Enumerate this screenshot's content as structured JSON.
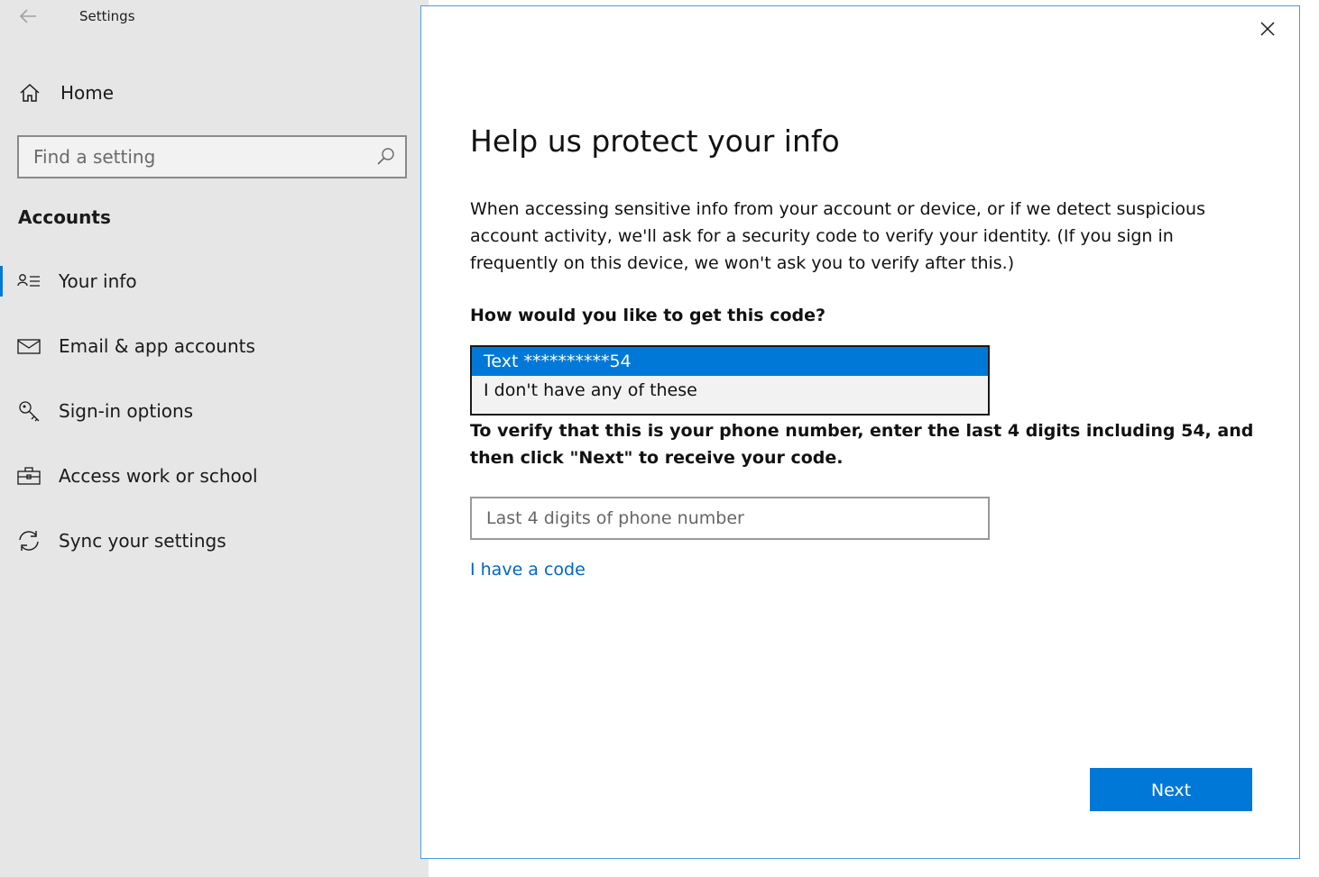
{
  "window": {
    "title": "Settings"
  },
  "sidebar": {
    "home_label": "Home",
    "search_placeholder": "Find a setting",
    "section_heading": "Accounts",
    "items": [
      {
        "label": "Your info",
        "icon": "person-list-icon",
        "active": true
      },
      {
        "label": "Email & app accounts",
        "icon": "mail-icon",
        "active": false
      },
      {
        "label": "Sign-in options",
        "icon": "key-icon",
        "active": false
      },
      {
        "label": "Access work or school",
        "icon": "briefcase-icon",
        "active": false
      },
      {
        "label": "Sync your settings",
        "icon": "sync-icon",
        "active": false
      }
    ]
  },
  "dialog": {
    "title": "Help us protect your info",
    "description": "When accessing sensitive info from your account or device, or if we detect suspicious account activity, we'll ask for a security code to verify your identity. (If you sign in frequently on this device, we won't ask you to verify after this.)",
    "question": "How would you like to get this code?",
    "options": [
      {
        "label": "Text **********54",
        "selected": true
      },
      {
        "label": "I don't have any of these",
        "selected": false
      }
    ],
    "verify_text": "To verify that this is your phone number, enter the last 4 digits including 54, and then click \"Next\" to receive your code.",
    "phone_placeholder": "Last 4 digits of phone number",
    "phone_value": "",
    "have_code_link": "I have a code",
    "next_label": "Next"
  },
  "colors": {
    "accent": "#0078d7",
    "link": "#0067c0",
    "sidebar_bg": "#e6e6e6"
  }
}
